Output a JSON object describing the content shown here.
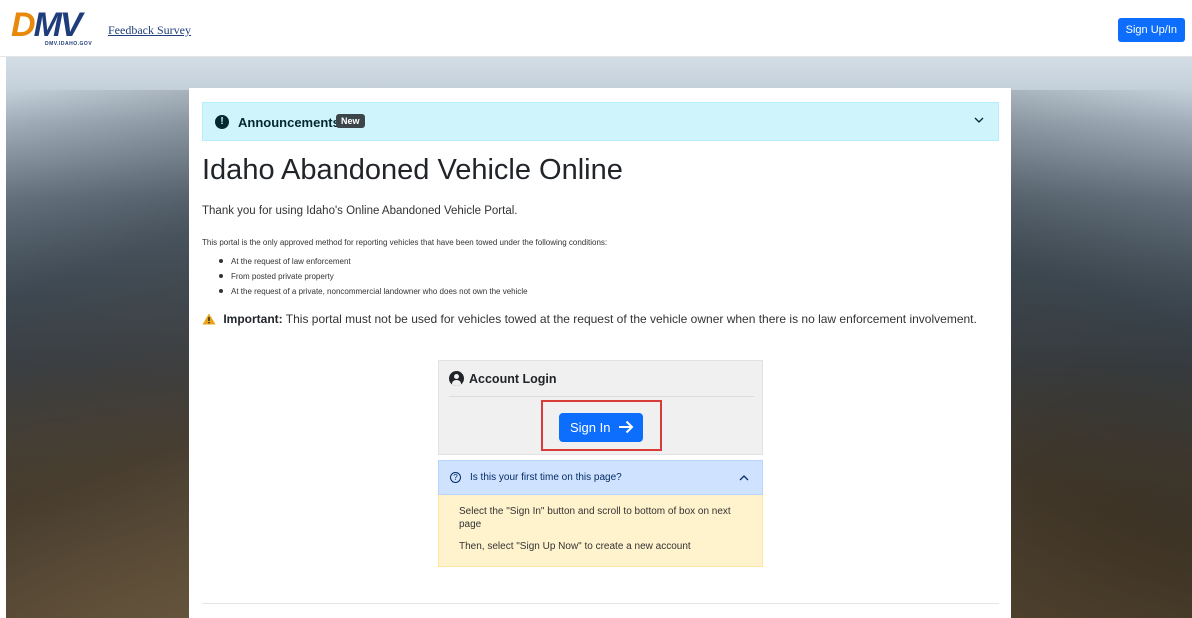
{
  "header": {
    "logo_text": "DMV",
    "logo_sub": "DMV.IDAHO.GOV",
    "feedback_link": "Feedback Survey",
    "signup_button": "Sign Up/In"
  },
  "announcement": {
    "title": "Announcements",
    "badge": "New",
    "icon": "exclamation-circle-icon"
  },
  "main": {
    "title": "Idaho Abandoned Vehicle Online",
    "thanks": "Thank you for using Idaho's Online Abandoned Vehicle Portal.",
    "description": "This portal is the only approved method for reporting vehicles that have been towed under the following conditions:",
    "conditions": [
      "At the request of law enforcement",
      "From posted private property",
      "At the request of a private, noncommercial landowner who does not own the vehicle"
    ],
    "important_label": "Important:",
    "important_text": "This portal must not be used for vehicles towed at the request of the vehicle owner when there is no law enforcement involvement."
  },
  "login": {
    "heading": "Account Login",
    "signin_button": "Sign In"
  },
  "first_time": {
    "question": "Is this your first time on this page?",
    "instruction1": "Select the \"Sign In\" button and scroll to bottom of box on next page",
    "instruction2": "Then, select \"Sign Up Now\" to create a new account"
  },
  "colors": {
    "primary": "#0d6efd",
    "info_bg": "#cff4fc",
    "warning_bg": "#fff3cd",
    "highlight": "#d93b3b"
  }
}
